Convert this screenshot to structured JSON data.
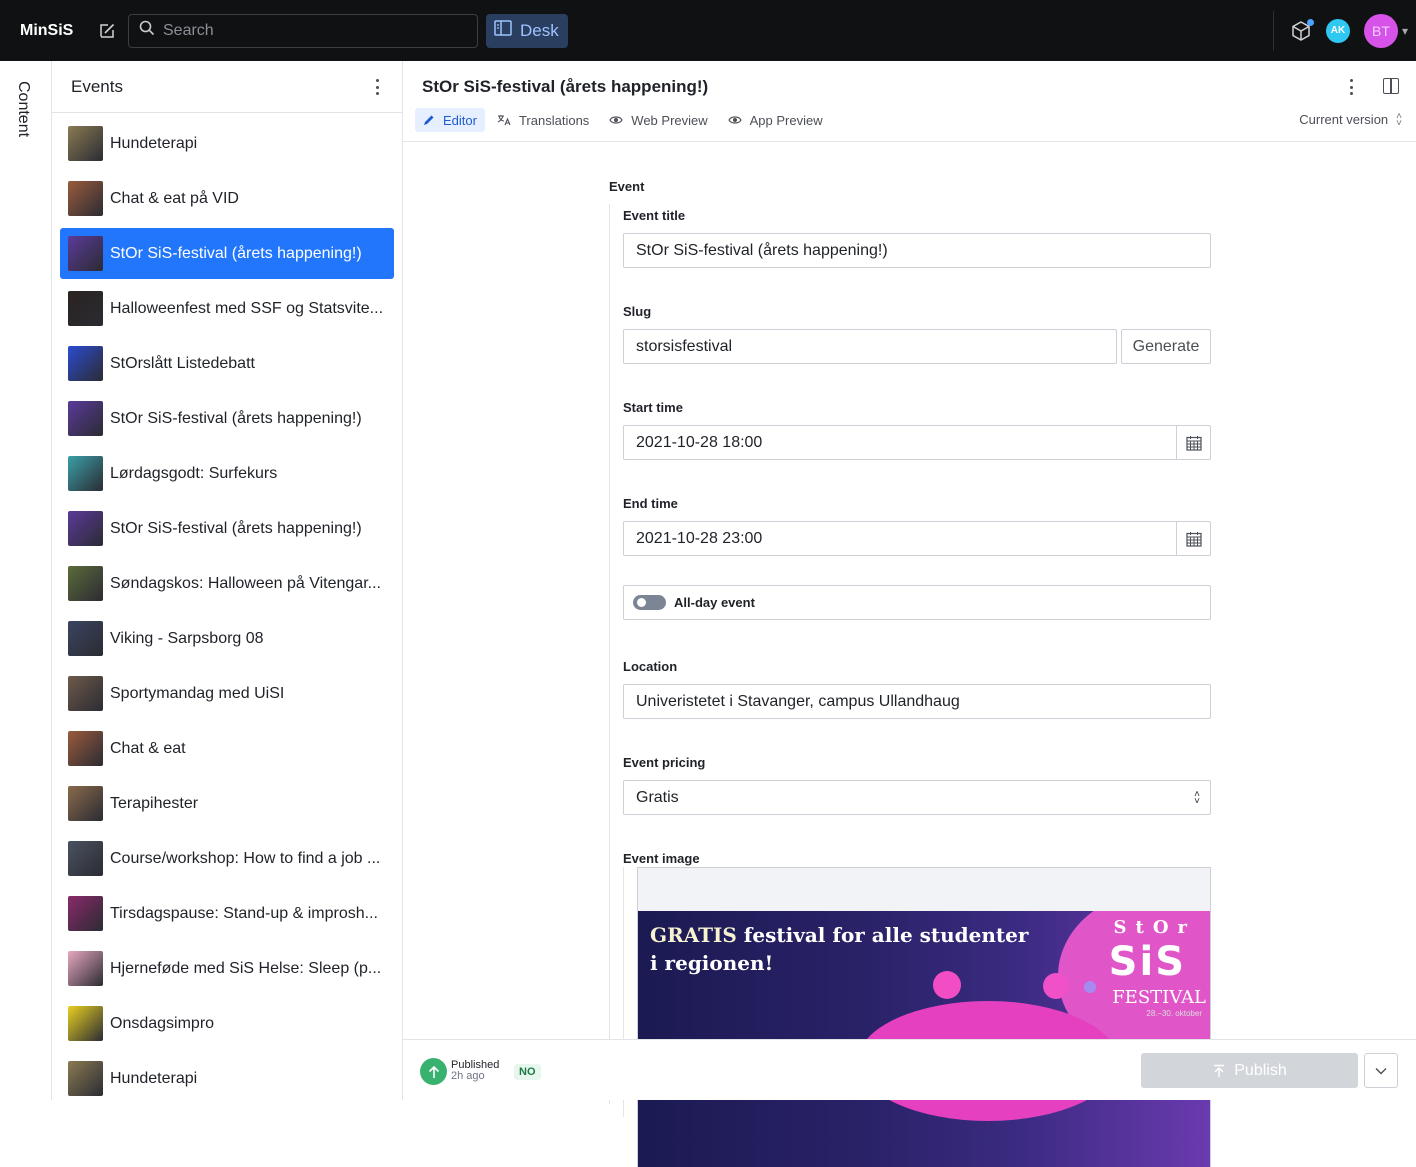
{
  "app": {
    "brand": "MinSiS",
    "search_placeholder": "Search",
    "desk_label": "Desk",
    "avatar_ak": "AK",
    "avatar_bt": "BT"
  },
  "rail": {
    "label": "Content"
  },
  "list": {
    "title": "Events",
    "items": [
      {
        "label": "Hundeterapi",
        "thumb": "#8a7b52"
      },
      {
        "label": "Chat & eat på VID",
        "thumb": "#9a5b3c"
      },
      {
        "label": "StOr SiS-festival (årets happening!)",
        "thumb": "#5b3a9a",
        "active": true
      },
      {
        "label": "Halloweenfest med SSF og Statsvite...",
        "thumb": "#2a2320"
      },
      {
        "label": "StOrslått Listedebatt",
        "thumb": "#2b4bd0"
      },
      {
        "label": "StOr SiS-festival (årets happening!)",
        "thumb": "#5b3a9a"
      },
      {
        "label": "Lørdagsgodt: Surfekurs",
        "thumb": "#3aa0a8"
      },
      {
        "label": "StOr SiS-festival (årets happening!)",
        "thumb": "#5b3a9a"
      },
      {
        "label": "Søndagskos: Halloween på Vitengar...",
        "thumb": "#5c6b3a"
      },
      {
        "label": "Viking - Sarpsborg 08",
        "thumb": "#3a4560"
      },
      {
        "label": "Sportymandag med UiSI",
        "thumb": "#6e5a4a"
      },
      {
        "label": "Chat & eat",
        "thumb": "#9a5b3c"
      },
      {
        "label": "Terapihester",
        "thumb": "#8a6a4a"
      },
      {
        "label": "Course/workshop: How to find a job ...",
        "thumb": "#4a5260"
      },
      {
        "label": "Tirsdagspause: Stand-up & improsh...",
        "thumb": "#8a2a6a"
      },
      {
        "label": "Hjernefødе med SiS Helse: Sleep (p...",
        "thumb": "#e8a8c0"
      },
      {
        "label": "Onsdagsimpro",
        "thumb": "#e8d020"
      },
      {
        "label": "Hundeterapi",
        "thumb": "#8a7b52"
      }
    ]
  },
  "doc": {
    "title": "StOr SiS-festival (årets happening!)",
    "tabs": [
      "Editor",
      "Translations",
      "Web Preview",
      "App Preview"
    ],
    "version": "Current version"
  },
  "form": {
    "section": "Event",
    "event_title_label": "Event title",
    "event_title_value": "StOr SiS-festival (årets happening!)",
    "slug_label": "Slug",
    "slug_value": "storsisfestival",
    "generate_label": "Generate",
    "start_label": "Start time",
    "start_value": "2021-10-28 18:00",
    "end_label": "End time",
    "end_value": "2021-10-28 23:00",
    "allday_label": "All-day event",
    "location_label": "Location",
    "location_value": "Univeristetet i Stavanger, campus Ullandhaug",
    "pricing_label": "Event pricing",
    "pricing_value": "Gratis",
    "image_label": "Event image",
    "image": {
      "headline_a": "GRATIS",
      "headline_b": " festival for alle studenter i regionen!",
      "logo_a": "StOr",
      "logo_b": "SiS",
      "logo_c": "FESTIVAL",
      "logo_d": "28.–30. oktober"
    }
  },
  "footer": {
    "status": "Published",
    "when": "2h ago",
    "lang": "NO",
    "publish_label": "Publish"
  }
}
